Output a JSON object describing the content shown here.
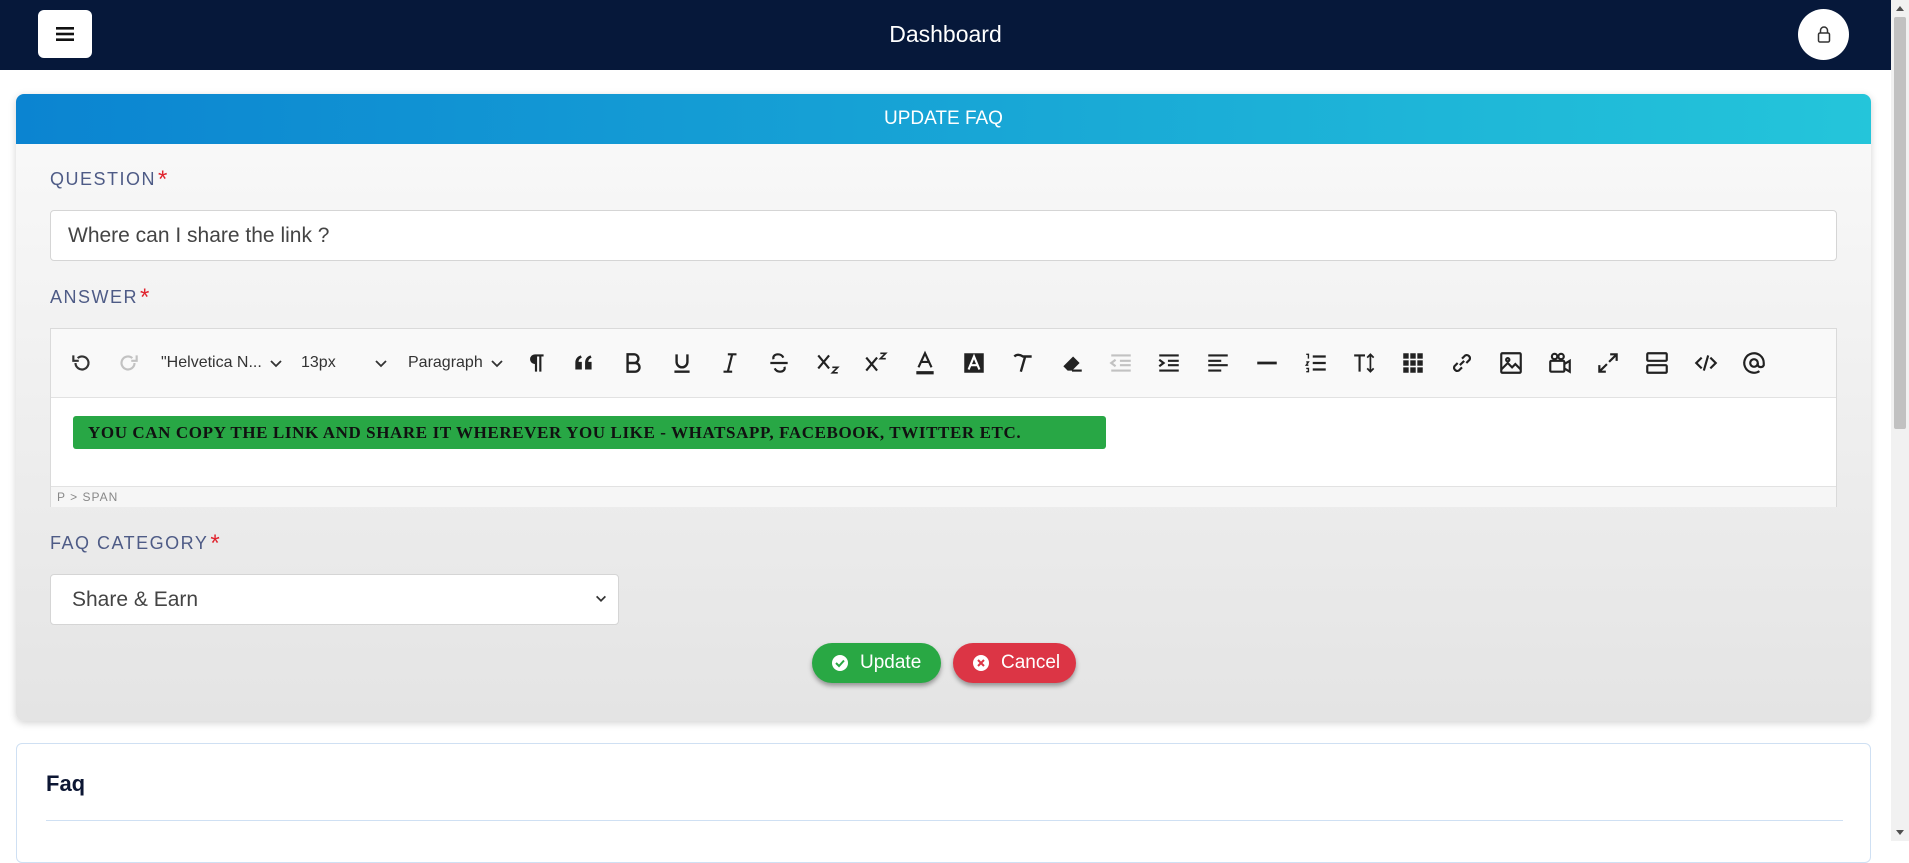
{
  "topbar": {
    "title": "Dashboard",
    "menu_icon": "hamburger-icon",
    "user_icon": "user-icon",
    "bg_color": "#06183a"
  },
  "form": {
    "header": "UPDATE FAQ",
    "question": {
      "label": "QUESTION",
      "required_mark": "*",
      "value": "Where can I share the link ?"
    },
    "answer": {
      "label": "ANSWER",
      "required_mark": "*",
      "toolbar": {
        "font_family": "\"Helvetica N...",
        "font_size": "13px",
        "block_format": "Paragraph"
      },
      "content": "YOU CAN COPY THE LINK AND SHARE IT WHEREVER YOU LIKE - WHATSAPP, FACEBOOK, TWITTER ETC.",
      "content_bg": "#28a745",
      "status_path": "P > SPAN"
    },
    "category": {
      "label": "FAQ CATEGORY",
      "required_mark": "*",
      "selected": "Share & Earn"
    },
    "buttons": {
      "update": "Update",
      "cancel": "Cancel"
    }
  },
  "faq_section": {
    "title": "Faq"
  },
  "colors": {
    "accent_start": "#0b84d1",
    "accent_end": "#24c5da",
    "success": "#29a844",
    "danger": "#dc3545",
    "required": "#e0242e"
  }
}
